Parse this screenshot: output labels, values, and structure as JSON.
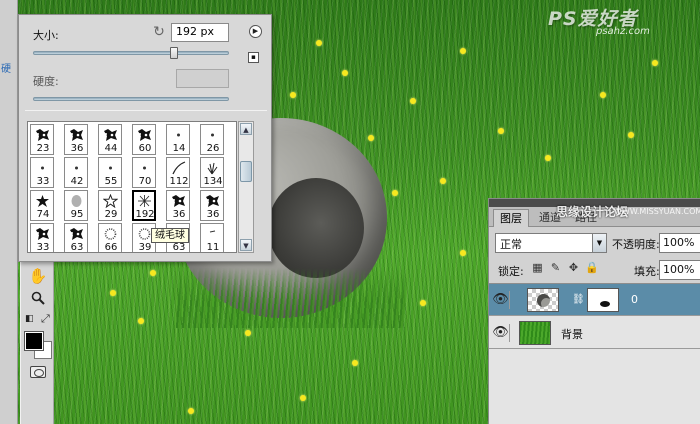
{
  "brush_panel": {
    "size_label": "大小:",
    "size_value": "192 px",
    "size_slider_fraction": 0.72,
    "hardness_label": "硬度:",
    "hardness_value": "",
    "tooltip": "绒毛球",
    "brushes": [
      {
        "num": "23",
        "icon": "splatter"
      },
      {
        "num": "36",
        "icon": "splatter"
      },
      {
        "num": "44",
        "icon": "splatter"
      },
      {
        "num": "60",
        "icon": "splatter"
      },
      {
        "num": "14",
        "icon": "dot"
      },
      {
        "num": "26",
        "icon": "dot"
      },
      {
        "num": "33",
        "icon": "dot"
      },
      {
        "num": "42",
        "icon": "dot"
      },
      {
        "num": "55",
        "icon": "dot"
      },
      {
        "num": "70",
        "icon": "dot"
      },
      {
        "num": "112",
        "icon": "stroke"
      },
      {
        "num": "134",
        "icon": "grass"
      },
      {
        "num": "74",
        "icon": "leaf"
      },
      {
        "num": "95",
        "icon": "soft-leaf"
      },
      {
        "num": "29",
        "icon": "star"
      },
      {
        "num": "192",
        "icon": "burst",
        "selected": true
      },
      {
        "num": "36",
        "icon": "splatter"
      },
      {
        "num": "36",
        "icon": "splatter"
      },
      {
        "num": "33",
        "icon": "splatter"
      },
      {
        "num": "63",
        "icon": "splatter"
      },
      {
        "num": "66",
        "icon": "fuzzy"
      },
      {
        "num": "39",
        "icon": "fuzzy"
      },
      {
        "num": "63",
        "icon": "splatter"
      },
      {
        "num": "11",
        "icon": "dash"
      }
    ]
  },
  "left_frame": {
    "blue_text": "硬"
  },
  "layers_panel": {
    "tabs": [
      "图层",
      "通道",
      "路径"
    ],
    "blend_mode": "正常",
    "opacity_label": "不透明度:",
    "opacity_value": "100%",
    "lock_label": "锁定:",
    "fill_label": "填充:",
    "fill_value": "100%",
    "layers": [
      {
        "name": "0",
        "selected": true
      },
      {
        "name": "背景",
        "selected": false
      }
    ]
  },
  "watermarks": {
    "top": "PS爱好者",
    "top_url": "psahz.com",
    "mid": "思缘设计论坛",
    "mid_url": "WWW.MISSYUAN.COM"
  },
  "colors": {
    "grass": "#3f9420",
    "flower": "#f6e81f",
    "panel": "#d8d8d8",
    "selected_layer": "#5b8ca8"
  }
}
